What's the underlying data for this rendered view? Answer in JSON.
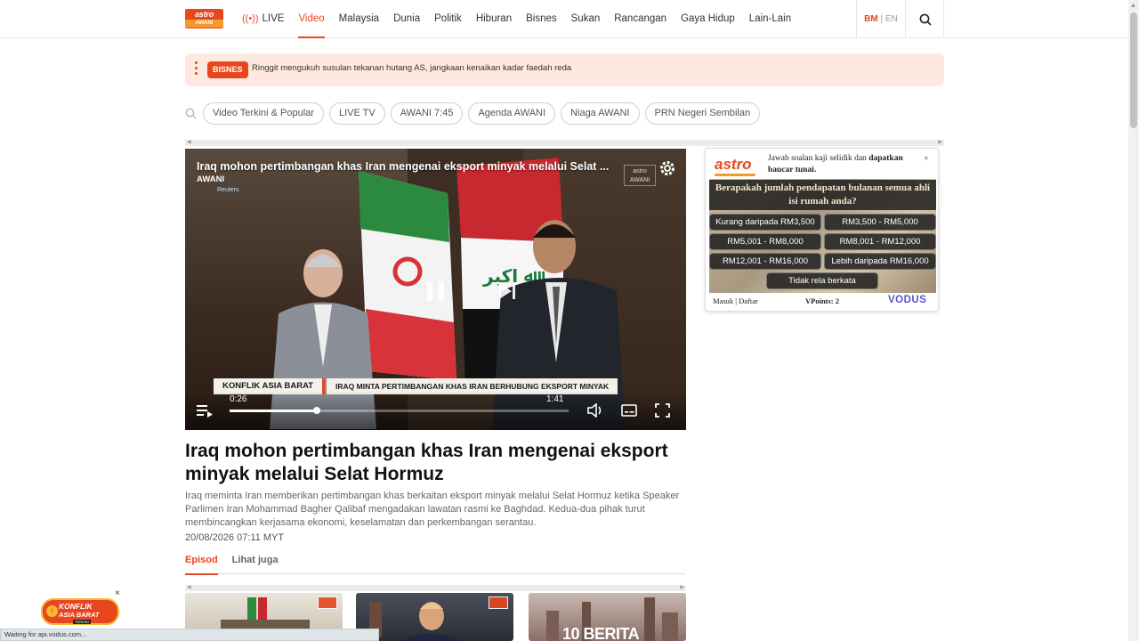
{
  "logo": {
    "line1": "astro",
    "line2": "AWANI"
  },
  "nav": {
    "live_label": "LIVE",
    "items": [
      "Video",
      "Malaysia",
      "Dunia",
      "Politik",
      "Hiburan",
      "Bisnes",
      "Sukan",
      "Rancangan",
      "Gaya Hidup",
      "Lain-Lain"
    ],
    "active": "Video"
  },
  "lang": {
    "bm": "BM",
    "sep": "|",
    "en": "EN"
  },
  "ticker": {
    "badge": "BISNES",
    "text": "Ringgit mengukuh susulan tekanan hutang AS, jangkaan kenaikan kadar faedah reda"
  },
  "pills": [
    "Video Terkini & Popular",
    "LIVE TV",
    "AWANI 7:45",
    "Agenda AWANI",
    "Niaga AWANI",
    "PRN Negeri Sembilan"
  ],
  "video": {
    "title": "Iraq mohon pertimbangan khas Iran mengenai eksport minyak melalui Selat ...",
    "source": "AWANI",
    "credit": "Reuters",
    "watermark_1": "astro",
    "watermark_2": "AWANI",
    "lower_third_tag": "KONFLIK ASIA BARAT",
    "lower_third_text": "IRAQ MINTA PERTIMBANGAN KHAS IRAN BERHUBUNG EKSPORT MINYAK",
    "current_time": "0:26",
    "duration": "1:41",
    "progress": 0.257
  },
  "article": {
    "title": "Iraq mohon pertimbangan khas Iran mengenai eksport minyak melalui Selat Hormuz",
    "description": "Iraq meminta Iran memberikan pertimbangan khas berkaitan eksport minyak melalui Selat Hormuz ketika Speaker Parlimen Iran Mohammad Bagher Qalibaf mengadakan lawatan rasmi ke Baghdad. Kedua-dua pihak turut membincangkan kerjasama ekonomi, keselamatan dan perkembangan serantau.",
    "date": "20/08/2026 07:11 MYT"
  },
  "tabs": [
    "Episod",
    "Lihat juga"
  ],
  "thumbnails": {
    "third_overlay": "10 BERITA"
  },
  "survey": {
    "logo": "astro",
    "prompt_plain_1": "Jawab soalan kaji selidik dan ",
    "prompt_bold_1": "dapatkan",
    "prompt_bold_2": "baucar tunai.",
    "close": "×",
    "question": "Berapakah jumlah pendapatan bulanan semua ahli isi rumah anda?",
    "options": [
      "Kurang daripada RM3,500",
      "RM3,500 - RM5,000",
      "RM5,001 - RM8,000",
      "RM8,001 - RM12,000",
      "RM12,001 - RM16,000",
      "Lebih daripada RM16,000",
      "Tidak rela berkata"
    ],
    "footer_login": "Masuk | Daftar",
    "vpoints": "VPoints: 2",
    "brand": "VODUS"
  },
  "float_badge": {
    "line1": "KONFLIK",
    "line2": "ASIA BARAT",
    "line3": "TERKINI",
    "close": "×"
  },
  "status_bar": "Waiting for api.vodus.com...",
  "colors": {
    "accent": "#e8461f",
    "ticker_bg": "#fde9df",
    "vodus": "#5b4fd3"
  }
}
